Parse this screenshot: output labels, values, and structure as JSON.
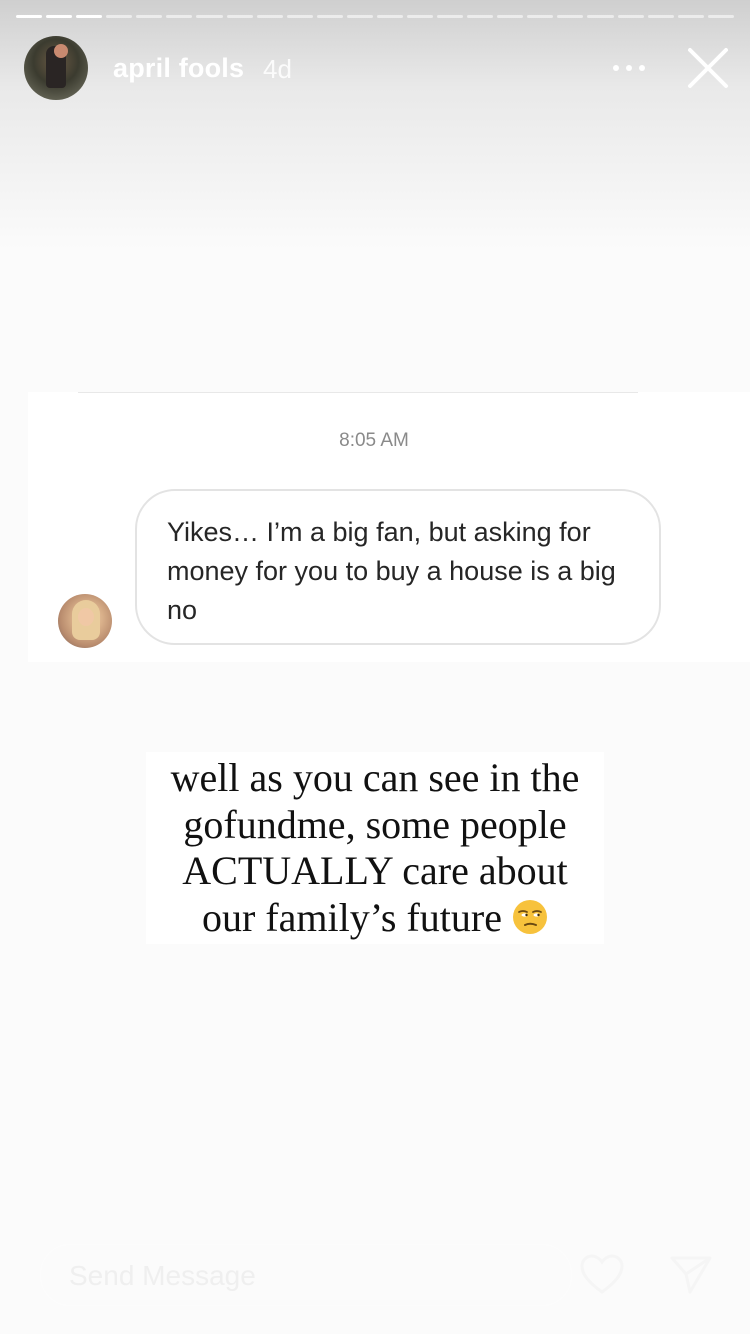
{
  "story": {
    "username": "april fools",
    "time_ago": "4d",
    "progress": {
      "total_segments": 24,
      "completed_segments": 3
    }
  },
  "dm_screenshot": {
    "timestamp": "8:05 AM",
    "message": "Yikes… I’m a big fan, but asking for money for you to buy a house is a big no"
  },
  "caption": {
    "lines": [
      "well as you can see in the",
      "gofundme, some people",
      "ACTUALLY care about",
      "our family’s future"
    ],
    "emoji": "unamused-face-icon"
  },
  "reply": {
    "placeholder": "Send Message"
  },
  "icons": {
    "more": "more-dots-icon",
    "close": "close-icon",
    "like": "heart-icon",
    "share": "send-icon"
  },
  "colors": {
    "text_dark": "#262626",
    "timestamp_gray": "#8a8a8a",
    "emoji_yellow": "#f7c23c"
  }
}
